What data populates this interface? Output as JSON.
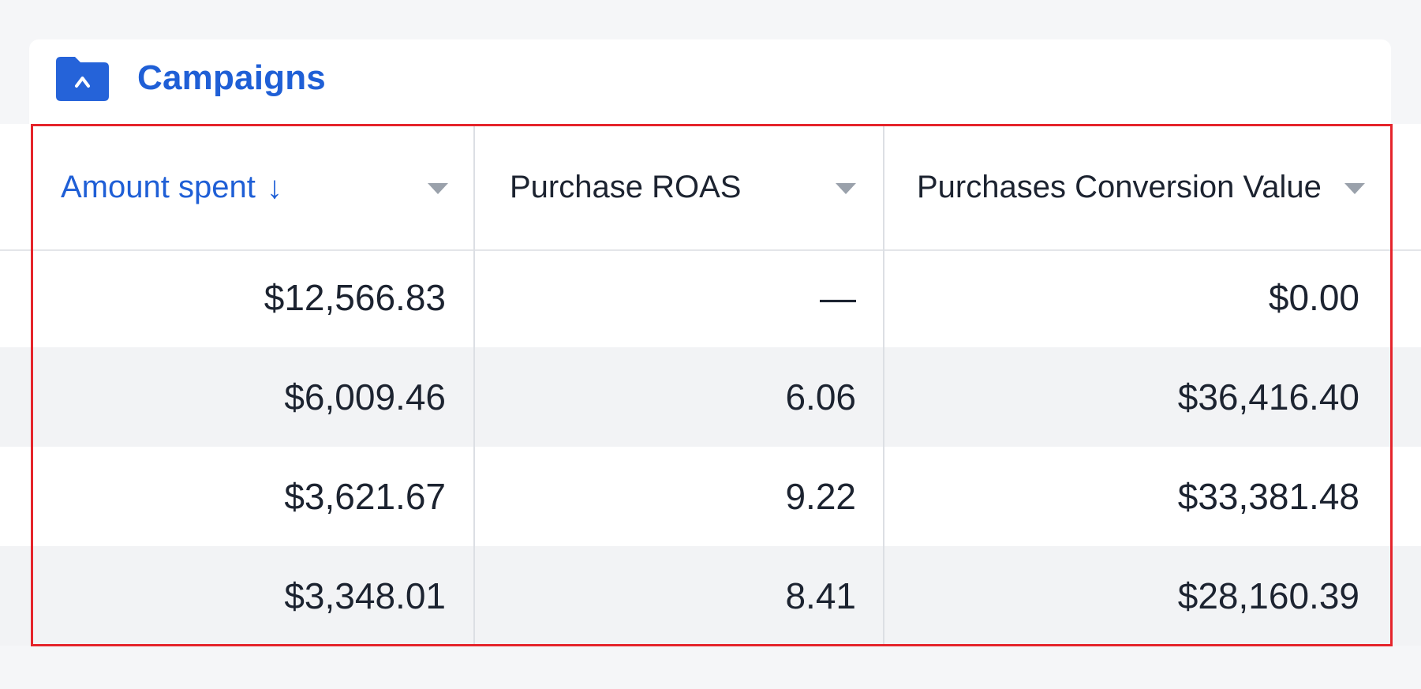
{
  "header": {
    "title": "Campaigns",
    "icon": "campaign-folder-icon",
    "accent_color": "#1f5fd6"
  },
  "table": {
    "columns": [
      {
        "label": "Amount spent",
        "sort_indicator": "↓",
        "sorted": true,
        "menu_icon": "caret-down-icon"
      },
      {
        "label": "Purchase ROAS",
        "sorted": false,
        "menu_icon": "caret-down-icon"
      },
      {
        "label": "Purchases Conversion Value",
        "sorted": false,
        "menu_icon": "caret-down-icon"
      }
    ],
    "rows": [
      [
        "$12,566.83",
        "—",
        "$0.00"
      ],
      [
        "$6,009.46",
        "6.06",
        "$36,416.40"
      ],
      [
        "$3,621.67",
        "9.22",
        "$33,381.48"
      ],
      [
        "$3,348.01",
        "8.41",
        "$28,160.39"
      ]
    ]
  },
  "highlight": {
    "color": "#e5242b"
  }
}
